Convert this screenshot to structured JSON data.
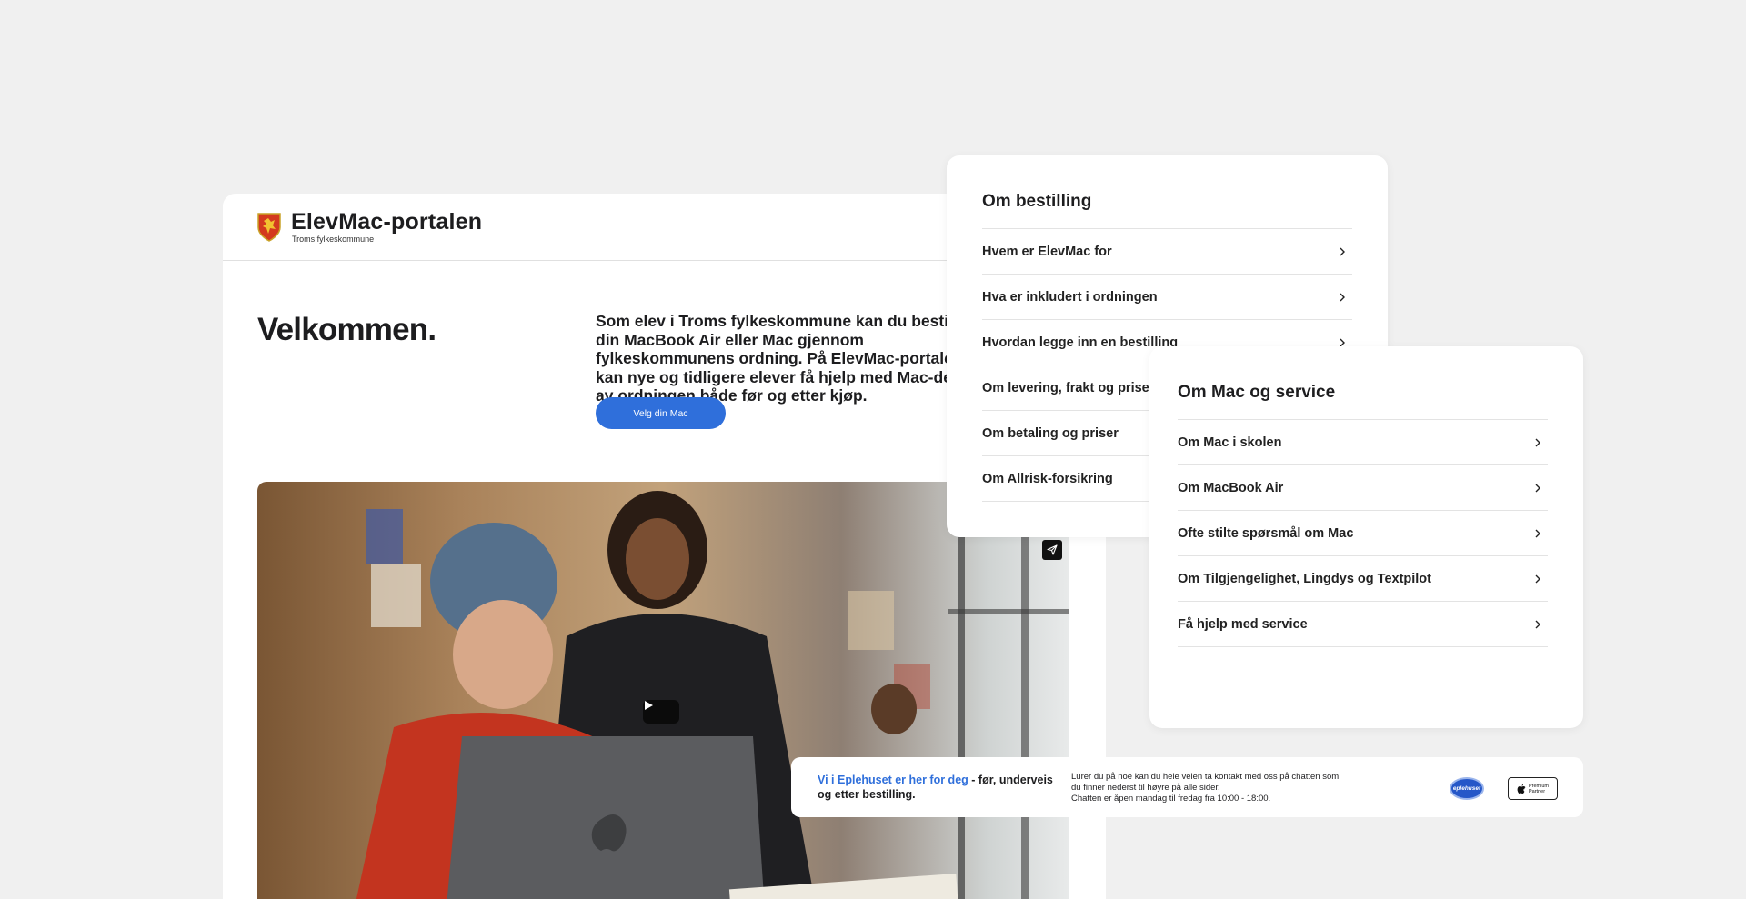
{
  "portal": {
    "brand_title": "ElevMac-portalen",
    "brand_subtitle": "Troms fylkeskommune",
    "welcome": "Velkommen.",
    "intro": "Som elev i Troms fylkeskommune kan du bestille din MacBook Air eller Mac gjennom fylkeskommunens ordning. På ElevMac-portalen kan nye og tidligere elever få hjelp med Mac-delen av ordningen både før og etter kjøp.",
    "cta_label": "Velg din Mac"
  },
  "order_panel": {
    "title": "Om bestilling",
    "items": [
      {
        "label": "Hvem er ElevMac for"
      },
      {
        "label": "Hva er inkludert i ordningen"
      },
      {
        "label": "Hvordan legge inn en bestilling"
      },
      {
        "label": "Om levering, frakt og priser"
      },
      {
        "label": "Om betaling og priser"
      },
      {
        "label": "Om Allrisk-forsikring"
      }
    ]
  },
  "mac_panel": {
    "title": "Om Mac og service",
    "items": [
      {
        "label": "Om Mac i skolen"
      },
      {
        "label": "Om MacBook Air"
      },
      {
        "label": "Ofte stilte spørsmål om Mac"
      },
      {
        "label": "Om Tilgjengelighet, Lingdys og Textpilot"
      },
      {
        "label": "Få hjelp med service"
      }
    ]
  },
  "banner": {
    "highlight": "Vi i Eplehuset er her for deg",
    "lead_rest": " - før, underveis og etter bestilling.",
    "info_line1": "Lurer du på noe kan du hele veien ta kontakt med oss på chatten som du finner nederst til høyre på alle sider.",
    "info_line2": "Chatten er åpen mandag til fredag fra 10:00 - 18:00.",
    "eplehuset_logo_text": "eplehuset",
    "apple_badge_line1": "Premium",
    "apple_badge_line2": "Partner"
  },
  "icons": {
    "crest": "troms-coat-of-arms-icon",
    "chevron": "chevron-right-icon",
    "play": "play-icon",
    "share": "paper-plane-share-icon"
  },
  "colors": {
    "accent_blue": "#2f6fdb",
    "background": "#f0f0f0",
    "card": "#ffffff"
  }
}
